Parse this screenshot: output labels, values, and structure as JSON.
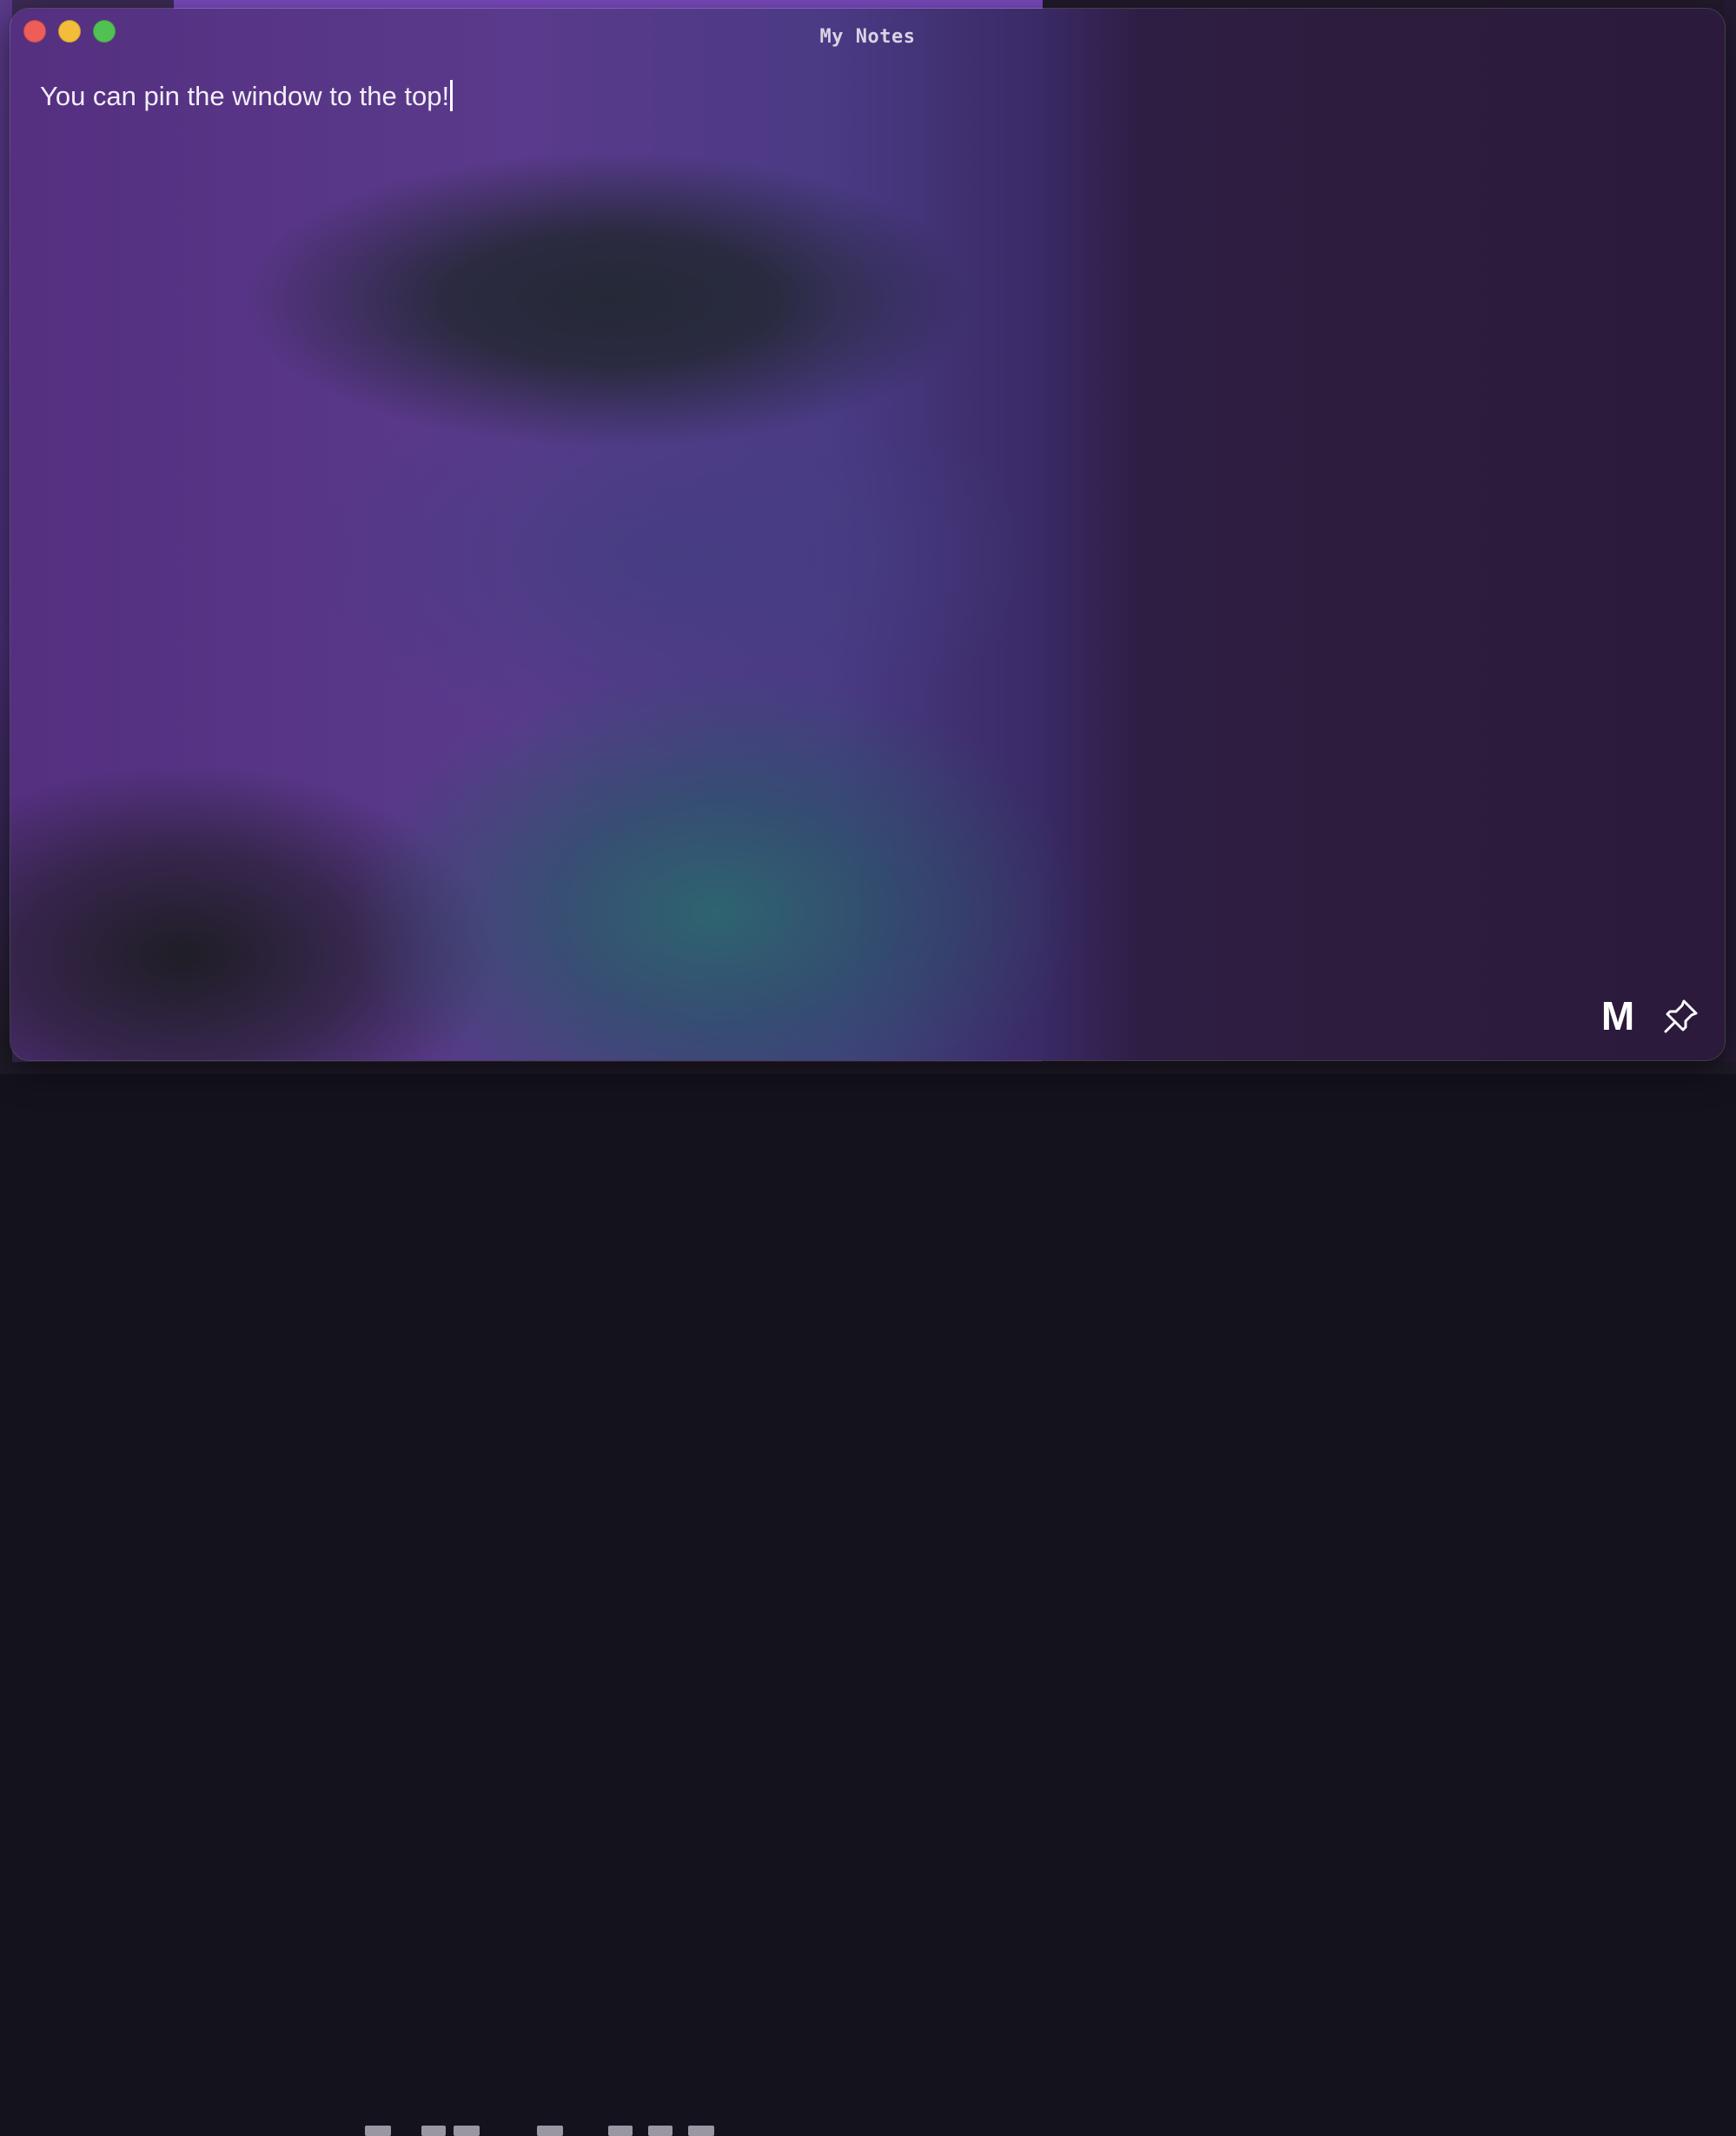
{
  "window": {
    "title": "My Notes"
  },
  "editor": {
    "text": "You can pin the window to the top!"
  },
  "controls": {
    "markdown_label": "M",
    "pin_icon": "pin-icon"
  },
  "colors": {
    "close": "#ee5d57",
    "minimize": "#f3bd3b",
    "zoom": "#52c154",
    "text": "#f1eef6"
  }
}
